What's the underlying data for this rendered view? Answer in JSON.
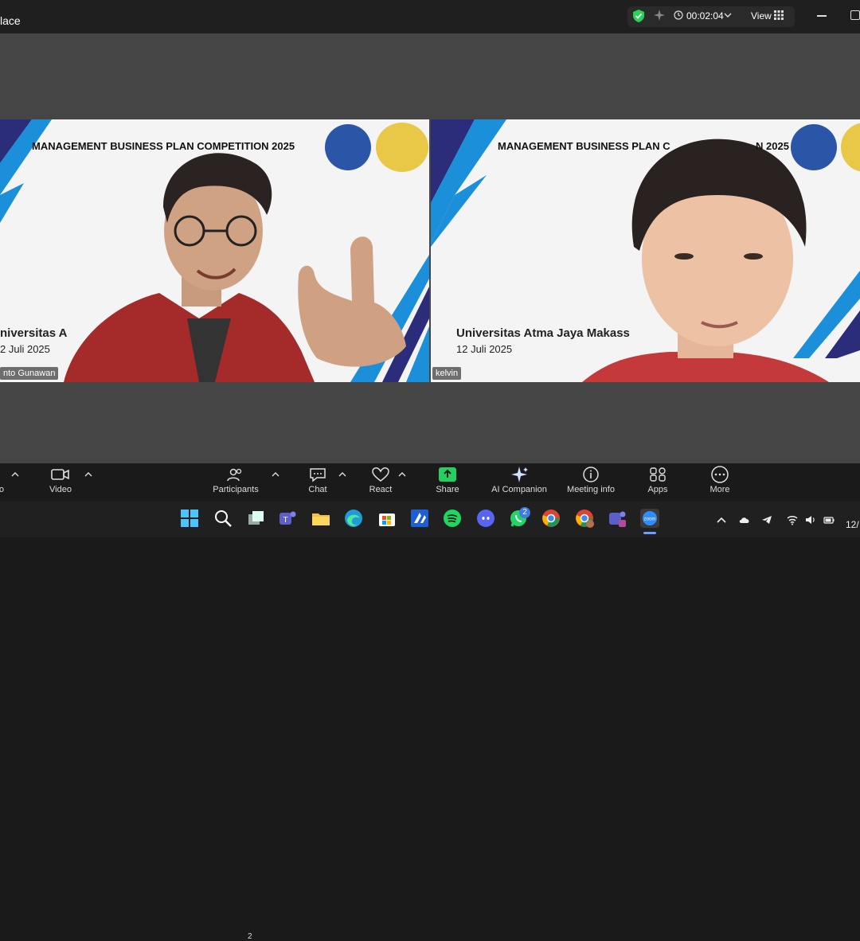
{
  "window": {
    "title": "lace"
  },
  "topbar": {
    "timer": "00:02:04",
    "view_label": "View"
  },
  "tiles": [
    {
      "banner": "MANAGEMENT BUSINESS PLAN COMPETITION 2025",
      "university": "niversitas A",
      "date": "2 Juli 2025",
      "name": "nto Gunawan"
    },
    {
      "banner": "MANAGEMENT BUSINESS PLAN C",
      "banner_tail": "N 2025",
      "university": "Universitas Atma Jaya Makass",
      "date": "12 Juli 2025",
      "name": "kelvin"
    }
  ],
  "toolbar": {
    "audio_label": "o",
    "video_label": "Video",
    "participants_label": "Participants",
    "participants_count": "2",
    "chat_label": "Chat",
    "react_label": "React",
    "share_label": "Share",
    "ai_label": "AI Companion",
    "info_label": "Meeting info",
    "apps_label": "Apps",
    "more_label": "More"
  },
  "taskbar": {
    "whatsapp_badge": "2",
    "date_partial": "12/"
  },
  "colors": {
    "share_green": "#23d160",
    "shield_green": "#2bd05a",
    "banner_blue": "#1b8fd9",
    "banner_navy": "#2b2d7a",
    "jacket_red": "#a52a2a"
  }
}
